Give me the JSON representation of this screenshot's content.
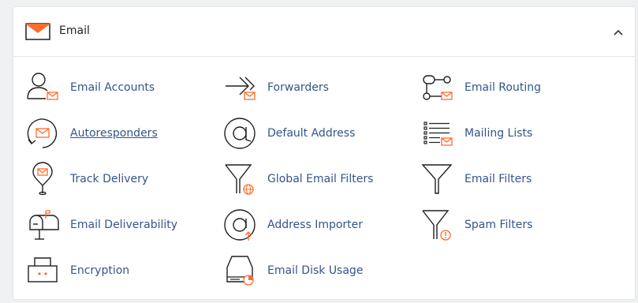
{
  "section": {
    "title": "Email",
    "icon": "envelope-icon",
    "collapse_icon": "chevron-up-icon"
  },
  "colors": {
    "link": "#33558a",
    "accent": "#ff6c2c",
    "icon_stroke": "#1f1f1f"
  },
  "items": [
    {
      "label": "Email Accounts",
      "icon": "user-email-icon"
    },
    {
      "label": "Forwarders",
      "icon": "forward-arrow-icon"
    },
    {
      "label": "Email Routing",
      "icon": "routing-icon"
    },
    {
      "label": "Autoresponders",
      "icon": "autoresponder-icon"
    },
    {
      "label": "Default Address",
      "icon": "at-sign-icon"
    },
    {
      "label": "Mailing Lists",
      "icon": "mailing-list-icon"
    },
    {
      "label": "Track Delivery",
      "icon": "location-pin-icon"
    },
    {
      "label": "Global Email Filters",
      "icon": "global-filter-icon"
    },
    {
      "label": "Email Filters",
      "icon": "filter-icon"
    },
    {
      "label": "Email Deliverability",
      "icon": "mailbox-icon"
    },
    {
      "label": "Address Importer",
      "icon": "import-at-icon"
    },
    {
      "label": "Spam Filters",
      "icon": "spam-filter-icon"
    },
    {
      "label": "Encryption",
      "icon": "encryption-icon"
    },
    {
      "label": "Email Disk Usage",
      "icon": "disk-usage-icon"
    }
  ]
}
